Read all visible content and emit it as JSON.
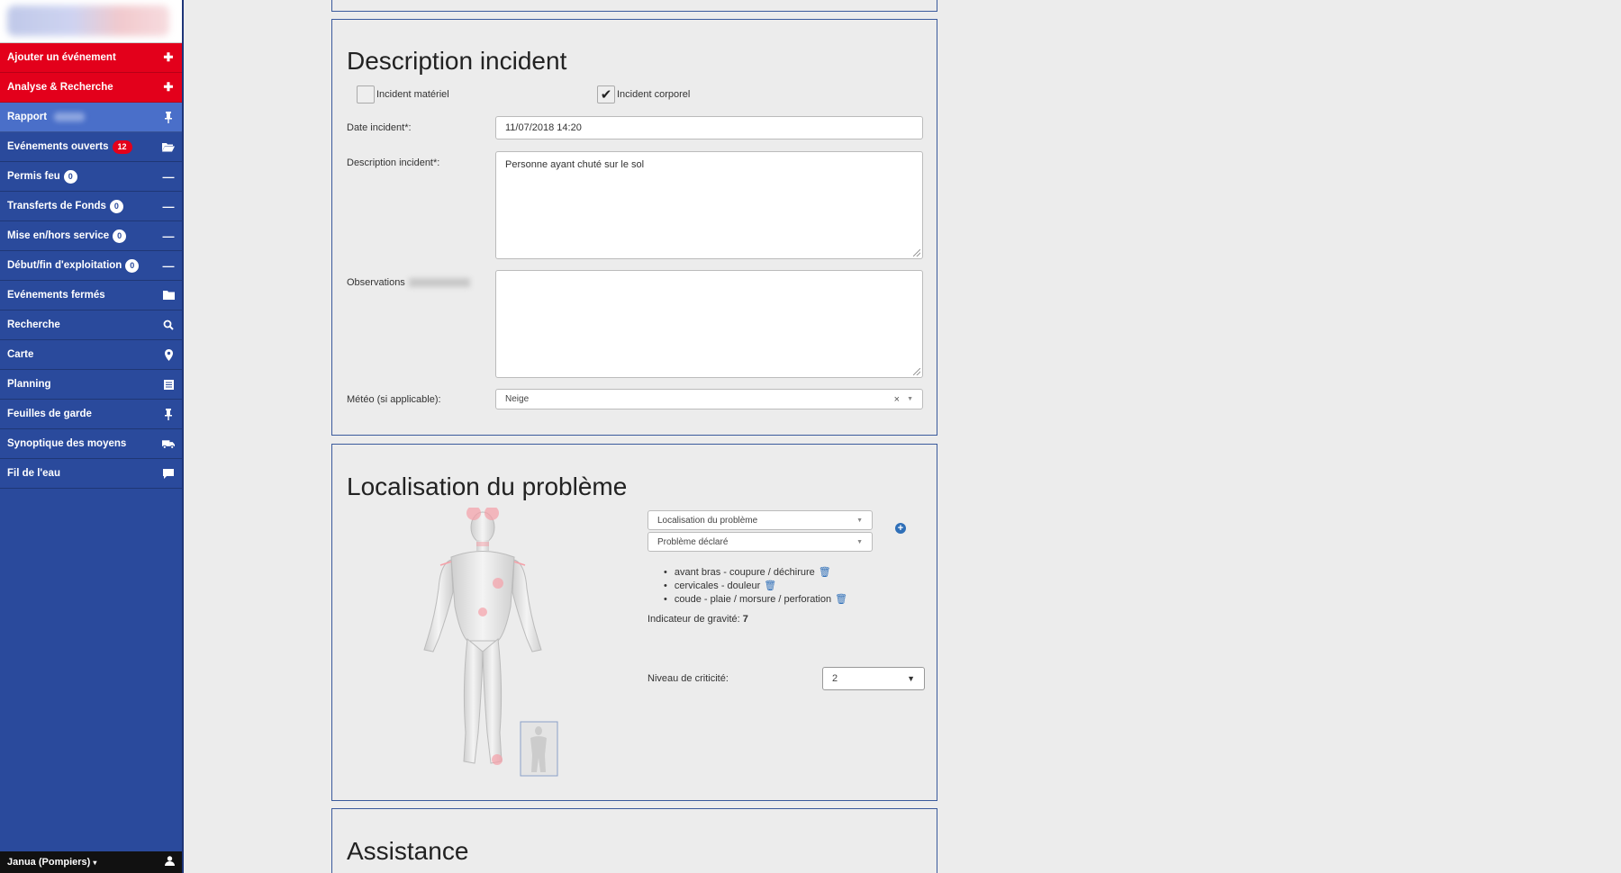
{
  "sidebar": {
    "items": [
      {
        "label": "Ajouter un événement",
        "icon": "plus-icon",
        "style": "red"
      },
      {
        "label": "Analyse & Recherche",
        "icon": "plus-icon",
        "style": "red"
      },
      {
        "label": "Rapport",
        "icon": "pin-icon",
        "style": "active"
      },
      {
        "label": "Evénements ouverts",
        "badge": "12",
        "icon": "folder-open-icon",
        "style": "normal"
      },
      {
        "label": "Permis feu",
        "badge": "0",
        "icon": "minus-icon",
        "style": "normal"
      },
      {
        "label": "Transferts de Fonds",
        "badge": "0",
        "icon": "minus-icon",
        "style": "normal"
      },
      {
        "label": "Mise en/hors service",
        "badge": "0",
        "icon": "minus-icon",
        "style": "normal"
      },
      {
        "label": "Début/fin d'exploitation",
        "badge": "0",
        "icon": "minus-icon",
        "style": "normal"
      },
      {
        "label": "Evénements fermés",
        "icon": "folder-icon",
        "style": "normal"
      },
      {
        "label": "Recherche",
        "icon": "search-icon",
        "style": "normal"
      },
      {
        "label": "Carte",
        "icon": "map-marker-icon",
        "style": "normal"
      },
      {
        "label": "Planning",
        "icon": "list-icon",
        "style": "normal"
      },
      {
        "label": "Feuilles de garde",
        "icon": "pin-icon",
        "style": "normal"
      },
      {
        "label": "Synoptique des moyens",
        "icon": "truck-icon",
        "style": "normal"
      },
      {
        "label": "Fil de l'eau",
        "icon": "comment-icon",
        "style": "normal"
      }
    ],
    "user": "Janua (Pompiers)"
  },
  "description": {
    "title": "Description incident",
    "checkbox_material": "Incident matériel",
    "checkbox_material_checked": false,
    "checkbox_corporal": "Incident corporel",
    "checkbox_corporal_checked": true,
    "date_label": "Date incident*:",
    "date_value": "11/07/2018 14:20",
    "desc_label": "Description incident*:",
    "desc_value": "Personne ayant chuté sur le sol",
    "obs_label": "Observations",
    "obs_value": "",
    "meteo_label": "Météo (si applicable):",
    "meteo_value": "Neige"
  },
  "localisation": {
    "title": "Localisation du problème",
    "select_location_placeholder": "Localisation du problème",
    "select_problem_placeholder": "Problème déclaré",
    "problems": [
      "avant bras - coupure / déchirure",
      "cervicales - douleur",
      "coude - plaie / morsure / perforation"
    ],
    "gravity_label": "Indicateur de gravité:",
    "gravity_value": "7",
    "criticity_label": "Niveau de criticité:",
    "criticity_value": "2"
  },
  "assistance": {
    "title": "Assistance"
  },
  "colors": {
    "sidebar_blue": "#2a4a9c",
    "accent_red": "#e3001b",
    "active_blue": "#4a6fc9",
    "link_blue": "#2f6fb8"
  }
}
